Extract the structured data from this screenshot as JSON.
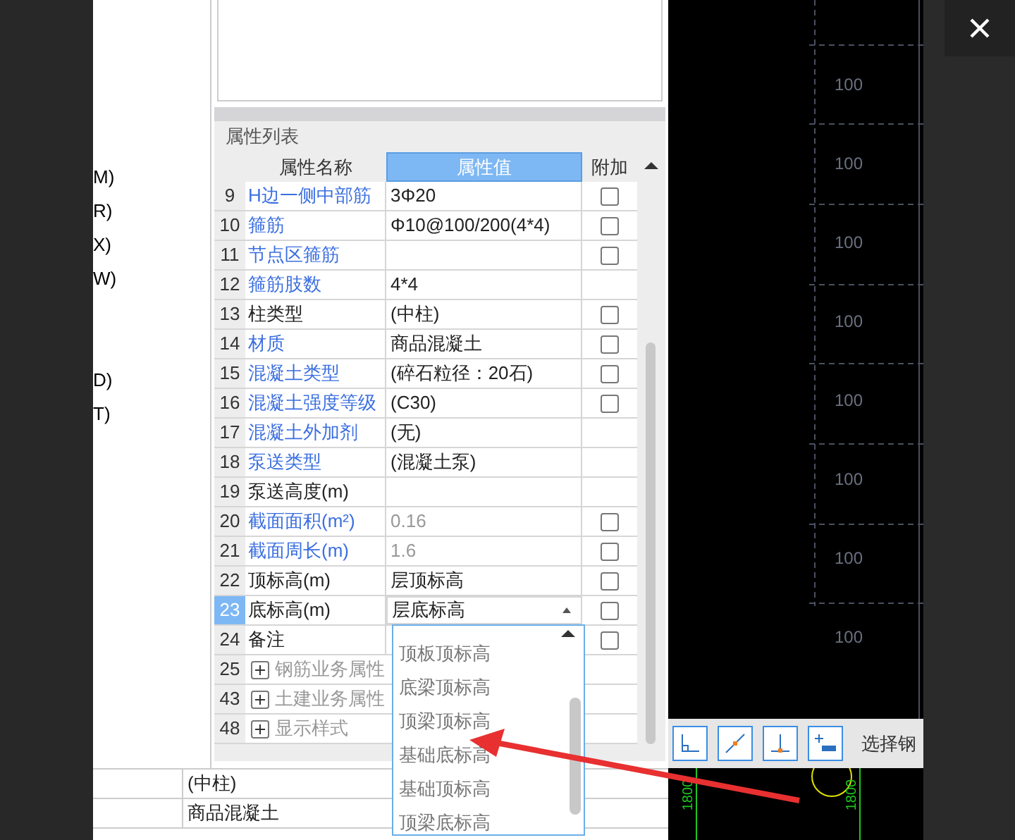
{
  "left_labels": [
    "M)",
    "R)",
    "X)",
    "W)",
    "D)",
    "T)"
  ],
  "panel": {
    "title": "属性列表",
    "columns": [
      "属性名称",
      "属性值",
      "附加"
    ],
    "rows": [
      {
        "kind": "prop",
        "num": "9",
        "name": "H边一侧中部筋",
        "name_blue": true,
        "value": "3Φ20",
        "value_grey": false,
        "checkbox": true,
        "checked": false,
        "selected": false
      },
      {
        "kind": "prop",
        "num": "10",
        "name": "箍筋",
        "name_blue": true,
        "value": "Φ10@100/200(4*4)",
        "value_grey": false,
        "checkbox": true,
        "checked": false,
        "selected": false
      },
      {
        "kind": "prop",
        "num": "11",
        "name": "节点区箍筋",
        "name_blue": true,
        "value": "",
        "value_grey": false,
        "checkbox": true,
        "checked": false,
        "selected": false
      },
      {
        "kind": "prop",
        "num": "12",
        "name": "箍筋肢数",
        "name_blue": true,
        "value": "4*4",
        "value_grey": false,
        "checkbox": false,
        "selected": false
      },
      {
        "kind": "prop",
        "num": "13",
        "name": "柱类型",
        "name_blue": false,
        "value": "(中柱)",
        "value_grey": false,
        "checkbox": true,
        "checked": false,
        "selected": false
      },
      {
        "kind": "prop",
        "num": "14",
        "name": "材质",
        "name_blue": true,
        "value": "商品混凝土",
        "value_grey": false,
        "checkbox": true,
        "checked": false,
        "selected": false
      },
      {
        "kind": "prop",
        "num": "15",
        "name": "混凝土类型",
        "name_blue": true,
        "value": "(碎石粒径：20石)",
        "value_grey": false,
        "checkbox": true,
        "checked": false,
        "selected": false
      },
      {
        "kind": "prop",
        "num": "16",
        "name": "混凝土强度等级",
        "name_blue": true,
        "value": "(C30)",
        "value_grey": false,
        "checkbox": true,
        "checked": false,
        "selected": false
      },
      {
        "kind": "prop",
        "num": "17",
        "name": "混凝土外加剂",
        "name_blue": true,
        "value": "(无)",
        "value_grey": false,
        "checkbox": false,
        "selected": false
      },
      {
        "kind": "prop",
        "num": "18",
        "name": "泵送类型",
        "name_blue": true,
        "value": "(混凝土泵)",
        "value_grey": false,
        "checkbox": false,
        "selected": false
      },
      {
        "kind": "prop",
        "num": "19",
        "name": "泵送高度(m)",
        "name_blue": false,
        "value": "",
        "value_grey": false,
        "checkbox": false,
        "selected": false
      },
      {
        "kind": "prop",
        "num": "20",
        "name": "截面面积(m²)",
        "name_blue": true,
        "value": "0.16",
        "value_grey": true,
        "checkbox": true,
        "checked": false,
        "selected": false
      },
      {
        "kind": "prop",
        "num": "21",
        "name": "截面周长(m)",
        "name_blue": true,
        "value": "1.6",
        "value_grey": true,
        "checkbox": true,
        "checked": false,
        "selected": false
      },
      {
        "kind": "prop",
        "num": "22",
        "name": "顶标高(m)",
        "name_blue": false,
        "value": "层顶标高",
        "value_grey": false,
        "checkbox": true,
        "checked": false,
        "selected": false
      },
      {
        "kind": "prop",
        "num": "23",
        "name": "底标高(m)",
        "name_blue": false,
        "value": "层底标高",
        "value_grey": false,
        "checkbox": true,
        "checked": false,
        "selected": true
      },
      {
        "kind": "prop",
        "num": "24",
        "name": "备注",
        "name_blue": false,
        "value": "",
        "value_grey": false,
        "checkbox": true,
        "checked": false,
        "selected": false
      },
      {
        "kind": "group",
        "num": "25",
        "name": "钢筋业务属性",
        "expanded": false,
        "selected": false
      },
      {
        "kind": "group",
        "num": "43",
        "name": "土建业务属性",
        "expanded": false,
        "selected": false
      },
      {
        "kind": "group",
        "num": "48",
        "name": "显示样式",
        "expanded": false,
        "selected": false
      }
    ],
    "dropdown": [
      "顶板顶标高",
      "底梁顶标高",
      "顶梁顶标高",
      "基础底标高",
      "基础顶标高",
      "顶梁底标高"
    ]
  },
  "bottom_rows": [
    "(中柱)",
    "商品混凝土"
  ],
  "cad": {
    "dimension_labels": [
      "100",
      "100",
      "100",
      "100",
      "100",
      "100",
      "100",
      "100"
    ],
    "bottom_labels": [
      "1800",
      "1800"
    ]
  },
  "toolbar": {
    "label": "选择钢"
  }
}
